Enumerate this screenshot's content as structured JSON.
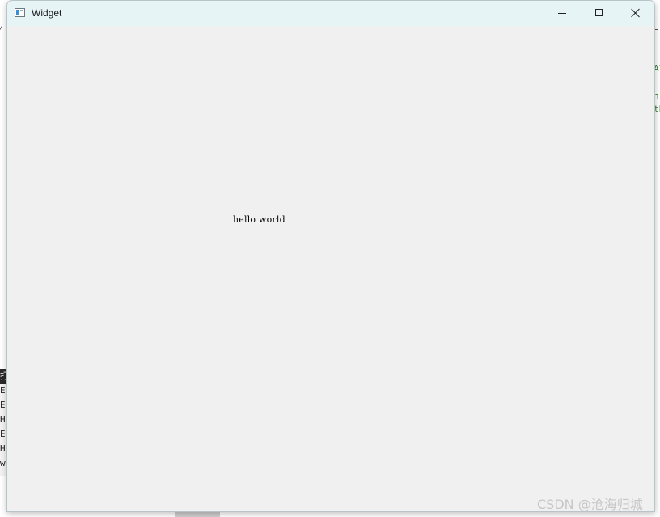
{
  "window": {
    "title": "Widget",
    "minimize_label": "Minimize",
    "maximize_label": "Maximize",
    "close_label": "Close"
  },
  "content": {
    "label": "hello world"
  },
  "background": {
    "right_code_lines": [
      "Al",
      "n",
      "th"
    ],
    "left_panel_lines": [
      "打",
      "En",
      "En",
      "He",
      "En",
      "He",
      "wi"
    ]
  },
  "watermark": "CSDN @沧海归城",
  "icons": {
    "app": "app-window-icon",
    "minimize": "minimize-icon",
    "maximize": "maximize-icon",
    "close": "close-icon"
  },
  "colors": {
    "titlebar": "#e6f4f6",
    "client": "#f0f0f0",
    "code_green": "#2e7d32"
  }
}
